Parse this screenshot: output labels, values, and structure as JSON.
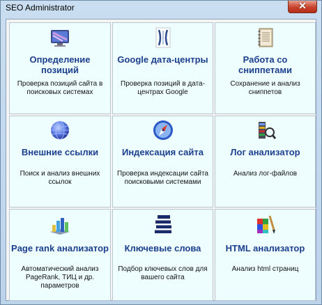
{
  "window": {
    "title": "SEO Administrator",
    "close_glyph": "✕"
  },
  "tiles": [
    {
      "title": "Определение позиций",
      "desc": "Проверка позиций сайта в поисковых системах",
      "icon": "monitor-icon"
    },
    {
      "title": "Google дата-центры",
      "desc": "Проверка позиций в дата-центрах Google",
      "icon": "datacenter-logo-icon"
    },
    {
      "title": "Работа со сниппетами",
      "desc": "Сохранение и анализ сниппетов",
      "icon": "notebook-icon"
    },
    {
      "title": "Внешние ссылки",
      "desc": "Поиск и анализ внешних ссылок",
      "icon": "globe-icon"
    },
    {
      "title": "Индексация сайта",
      "desc": "Проверка индексации сайта поисковыми системами",
      "icon": "compass-icon"
    },
    {
      "title": "Лог анализатор",
      "desc": "Анализ лог-файлов",
      "icon": "log-magnifier-icon"
    },
    {
      "title": "Page rank анализатор",
      "desc": "Автоматический анализ PageRank, ТИЦ и др. параметров",
      "icon": "bar-chart-icon"
    },
    {
      "title": "Ключевые слова",
      "desc": "Подбор ключевых слов для вашего сайта",
      "icon": "books-icon"
    },
    {
      "title": "HTML анализатор",
      "desc": "Анализ html страниц",
      "icon": "palette-icon"
    }
  ]
}
